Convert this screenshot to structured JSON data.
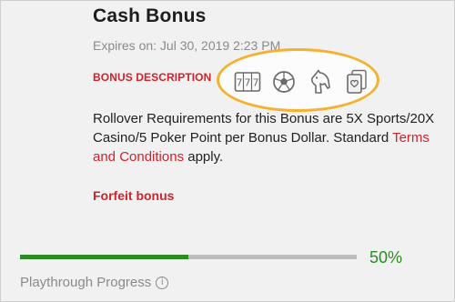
{
  "bonus": {
    "title": "Cash Bonus",
    "expires": "Expires on: Jul 30, 2019 2:23 PM",
    "description_label": "BONUS DESCRIPTION",
    "icons": [
      "slot-machine-777-icon",
      "soccer-ball-icon",
      "horse-head-icon",
      "playing-cards-heart-icon"
    ],
    "body_prefix": "Rollover Requirements for this Bonus are 5X Sports/20X Casino/5 Poker Point per Bonus Dollar. Standard ",
    "terms_link": "Terms and Conditions",
    "body_suffix": " apply.",
    "forfeit_label": "Forfeit bonus"
  },
  "progress": {
    "value_label": "50%",
    "fraction": 0.5,
    "label": "Playthrough Progress",
    "info_icon": "info-circle-icon"
  },
  "colors": {
    "accent_red": "#d0232b",
    "progress_green": "#2c8a24",
    "highlight_orange": "#f5b230"
  }
}
